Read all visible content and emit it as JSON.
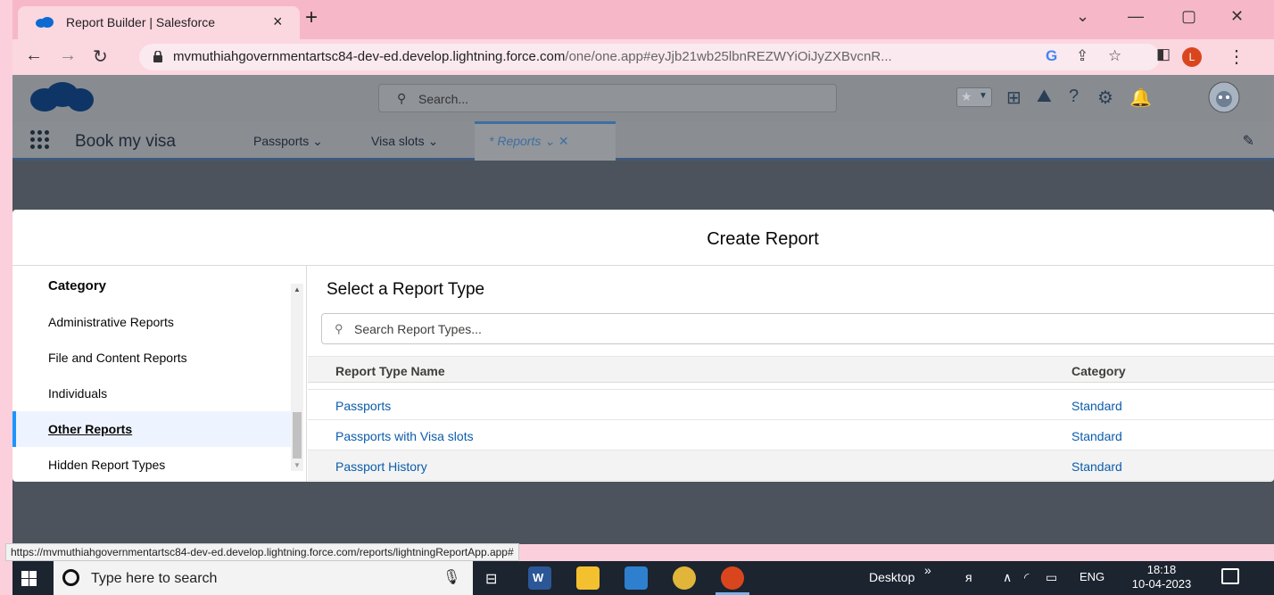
{
  "browser": {
    "tab_title": "Report Builder | Salesforce",
    "tab_close": "×",
    "new_tab": "+",
    "url_host": "mvmuthiahgovernmentartsc84-dev-ed.develop.lightning.force.com",
    "url_rest": "/one/one.app#eyJjb21wb25lbnREZWYiOiJyZXBvcnR...",
    "profile_initial": "L"
  },
  "sf_header": {
    "search_placeholder": "Search..."
  },
  "sf_nav": {
    "app_name": "Book my visa",
    "items": [
      {
        "label": "Passports"
      },
      {
        "label": "Visa slots"
      },
      {
        "label": "* Reports"
      }
    ]
  },
  "modal": {
    "title": "Create Report",
    "category_heading": "Category",
    "categories": [
      {
        "label": "Administrative Reports"
      },
      {
        "label": "File and Content Reports"
      },
      {
        "label": "Individuals"
      },
      {
        "label": "Other Reports",
        "selected": true
      },
      {
        "label": "Hidden Report Types"
      }
    ],
    "type_heading": "Select a Report Type",
    "type_search_placeholder": "Search Report Types...",
    "columns": {
      "name": "Report Type Name",
      "category": "Category"
    },
    "rows": [
      {
        "name": "Passports",
        "category": "Standard"
      },
      {
        "name": "Passports with Visa slots",
        "category": "Standard"
      },
      {
        "name": "Passport History",
        "category": "Standard"
      }
    ]
  },
  "status_url": "https://mvmuthiahgovernmentartsc84-dev-ed.develop.lightning.force.com/reports/lightningReportApp.app#",
  "taskbar": {
    "search_placeholder": "Type here to search",
    "desktop_label": "Desktop",
    "language": "ENG",
    "time": "18:18",
    "date": "10-04-2023"
  },
  "colors": {
    "accent": "#1b96ff",
    "link": "#0b5cab",
    "frame_pink": "#fbd0dc"
  }
}
